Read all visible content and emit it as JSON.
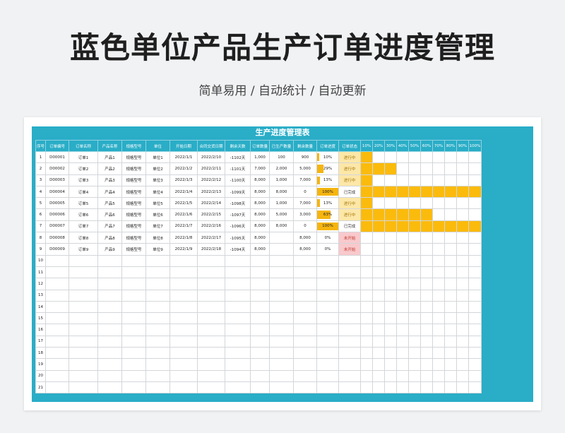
{
  "header": {
    "title": "蓝色单位产品生产订单进度管理",
    "subtitle": "简单易用 / 自动统计 / 自动更新"
  },
  "sheet": {
    "title": "生产进度管理表",
    "columns": [
      "序号",
      "订单编号",
      "订单名称",
      "产品名称",
      "规格型号",
      "单位",
      "开始日期",
      "合同交货日期",
      "剩余天数",
      "订单数量",
      "已生产数量",
      "剩余数量",
      "订单进度",
      "订单状态"
    ],
    "gantt_columns": [
      "10%",
      "20%",
      "30%",
      "40%",
      "50%",
      "60%",
      "70%",
      "80%",
      "90%",
      "100%"
    ],
    "rows": [
      {
        "no": "1",
        "order_id": "D00001",
        "order_name": "订单1",
        "product": "产品1",
        "spec": "规格型号",
        "unit": "单位1",
        "start": "2022/1/1",
        "due": "2022/2/10",
        "remaining_days": "-1102天",
        "qty": "1,000",
        "produced": "100",
        "remaining": "900",
        "progress_label": "10%",
        "progress": 0.1,
        "status": "进行中",
        "status_type": "doing"
      },
      {
        "no": "2",
        "order_id": "D00002",
        "order_name": "订单2",
        "product": "产品2",
        "spec": "规格型号",
        "unit": "单位2",
        "start": "2022/1/2",
        "due": "2022/2/11",
        "remaining_days": "-1101天",
        "qty": "7,000",
        "produced": "2,000",
        "remaining": "5,000",
        "progress_label": "29%",
        "progress": 0.29,
        "status": "进行中",
        "status_type": "doing"
      },
      {
        "no": "3",
        "order_id": "D00003",
        "order_name": "订单3",
        "product": "产品3",
        "spec": "规格型号",
        "unit": "单位3",
        "start": "2022/1/3",
        "due": "2022/2/12",
        "remaining_days": "-1100天",
        "qty": "8,000",
        "produced": "1,000",
        "remaining": "7,000",
        "progress_label": "13%",
        "progress": 0.13,
        "status": "进行中",
        "status_type": "doing"
      },
      {
        "no": "4",
        "order_id": "D00004",
        "order_name": "订单4",
        "product": "产品4",
        "spec": "规格型号",
        "unit": "单位4",
        "start": "2022/1/4",
        "due": "2022/2/13",
        "remaining_days": "-1099天",
        "qty": "8,000",
        "produced": "8,000",
        "remaining": "0",
        "progress_label": "100%",
        "progress": 1.0,
        "status": "已完成",
        "status_type": "done"
      },
      {
        "no": "5",
        "order_id": "D00005",
        "order_name": "订单5",
        "product": "产品5",
        "spec": "规格型号",
        "unit": "单位5",
        "start": "2022/1/5",
        "due": "2022/2/14",
        "remaining_days": "-1098天",
        "qty": "8,000",
        "produced": "1,000",
        "remaining": "7,000",
        "progress_label": "13%",
        "progress": 0.13,
        "status": "进行中",
        "status_type": "doing"
      },
      {
        "no": "6",
        "order_id": "D00006",
        "order_name": "订单6",
        "product": "产品6",
        "spec": "规格型号",
        "unit": "单位6",
        "start": "2022/1/6",
        "due": "2022/2/15",
        "remaining_days": "-1097天",
        "qty": "8,000",
        "produced": "5,000",
        "remaining": "3,000",
        "progress_label": "63%",
        "progress": 0.63,
        "status": "进行中",
        "status_type": "doing"
      },
      {
        "no": "7",
        "order_id": "D00007",
        "order_name": "订单7",
        "product": "产品7",
        "spec": "规格型号",
        "unit": "单位7",
        "start": "2022/1/7",
        "due": "2022/2/16",
        "remaining_days": "-1096天",
        "qty": "8,000",
        "produced": "8,000",
        "remaining": "0",
        "progress_label": "100%",
        "progress": 1.0,
        "status": "已完成",
        "status_type": "done"
      },
      {
        "no": "8",
        "order_id": "D00008",
        "order_name": "订单8",
        "product": "产品8",
        "spec": "规格型号",
        "unit": "单位8",
        "start": "2022/1/8",
        "due": "2022/2/17",
        "remaining_days": "-1095天",
        "qty": "8,000",
        "produced": "",
        "remaining": "8,000",
        "progress_label": "0%",
        "progress": 0,
        "status": "未开始",
        "status_type": "todo"
      },
      {
        "no": "9",
        "order_id": "D00009",
        "order_name": "订单9",
        "product": "产品9",
        "spec": "规格型号",
        "unit": "单位9",
        "start": "2022/1/9",
        "due": "2022/2/18",
        "remaining_days": "-1094天",
        "qty": "8,000",
        "produced": "",
        "remaining": "8,000",
        "progress_label": "0%",
        "progress": 0,
        "status": "未开始",
        "status_type": "todo"
      }
    ],
    "empty_row_numbers": [
      "10",
      "11",
      "12",
      "13",
      "14",
      "15",
      "16",
      "17",
      "18",
      "19",
      "20",
      "21"
    ]
  },
  "colors": {
    "accent": "#2aadc7",
    "gantt": "#fbbb0c",
    "progress_bar": "#f5b510",
    "status_doing_bg": "#fde7a8",
    "status_todo_bg": "#f9c9cc"
  }
}
